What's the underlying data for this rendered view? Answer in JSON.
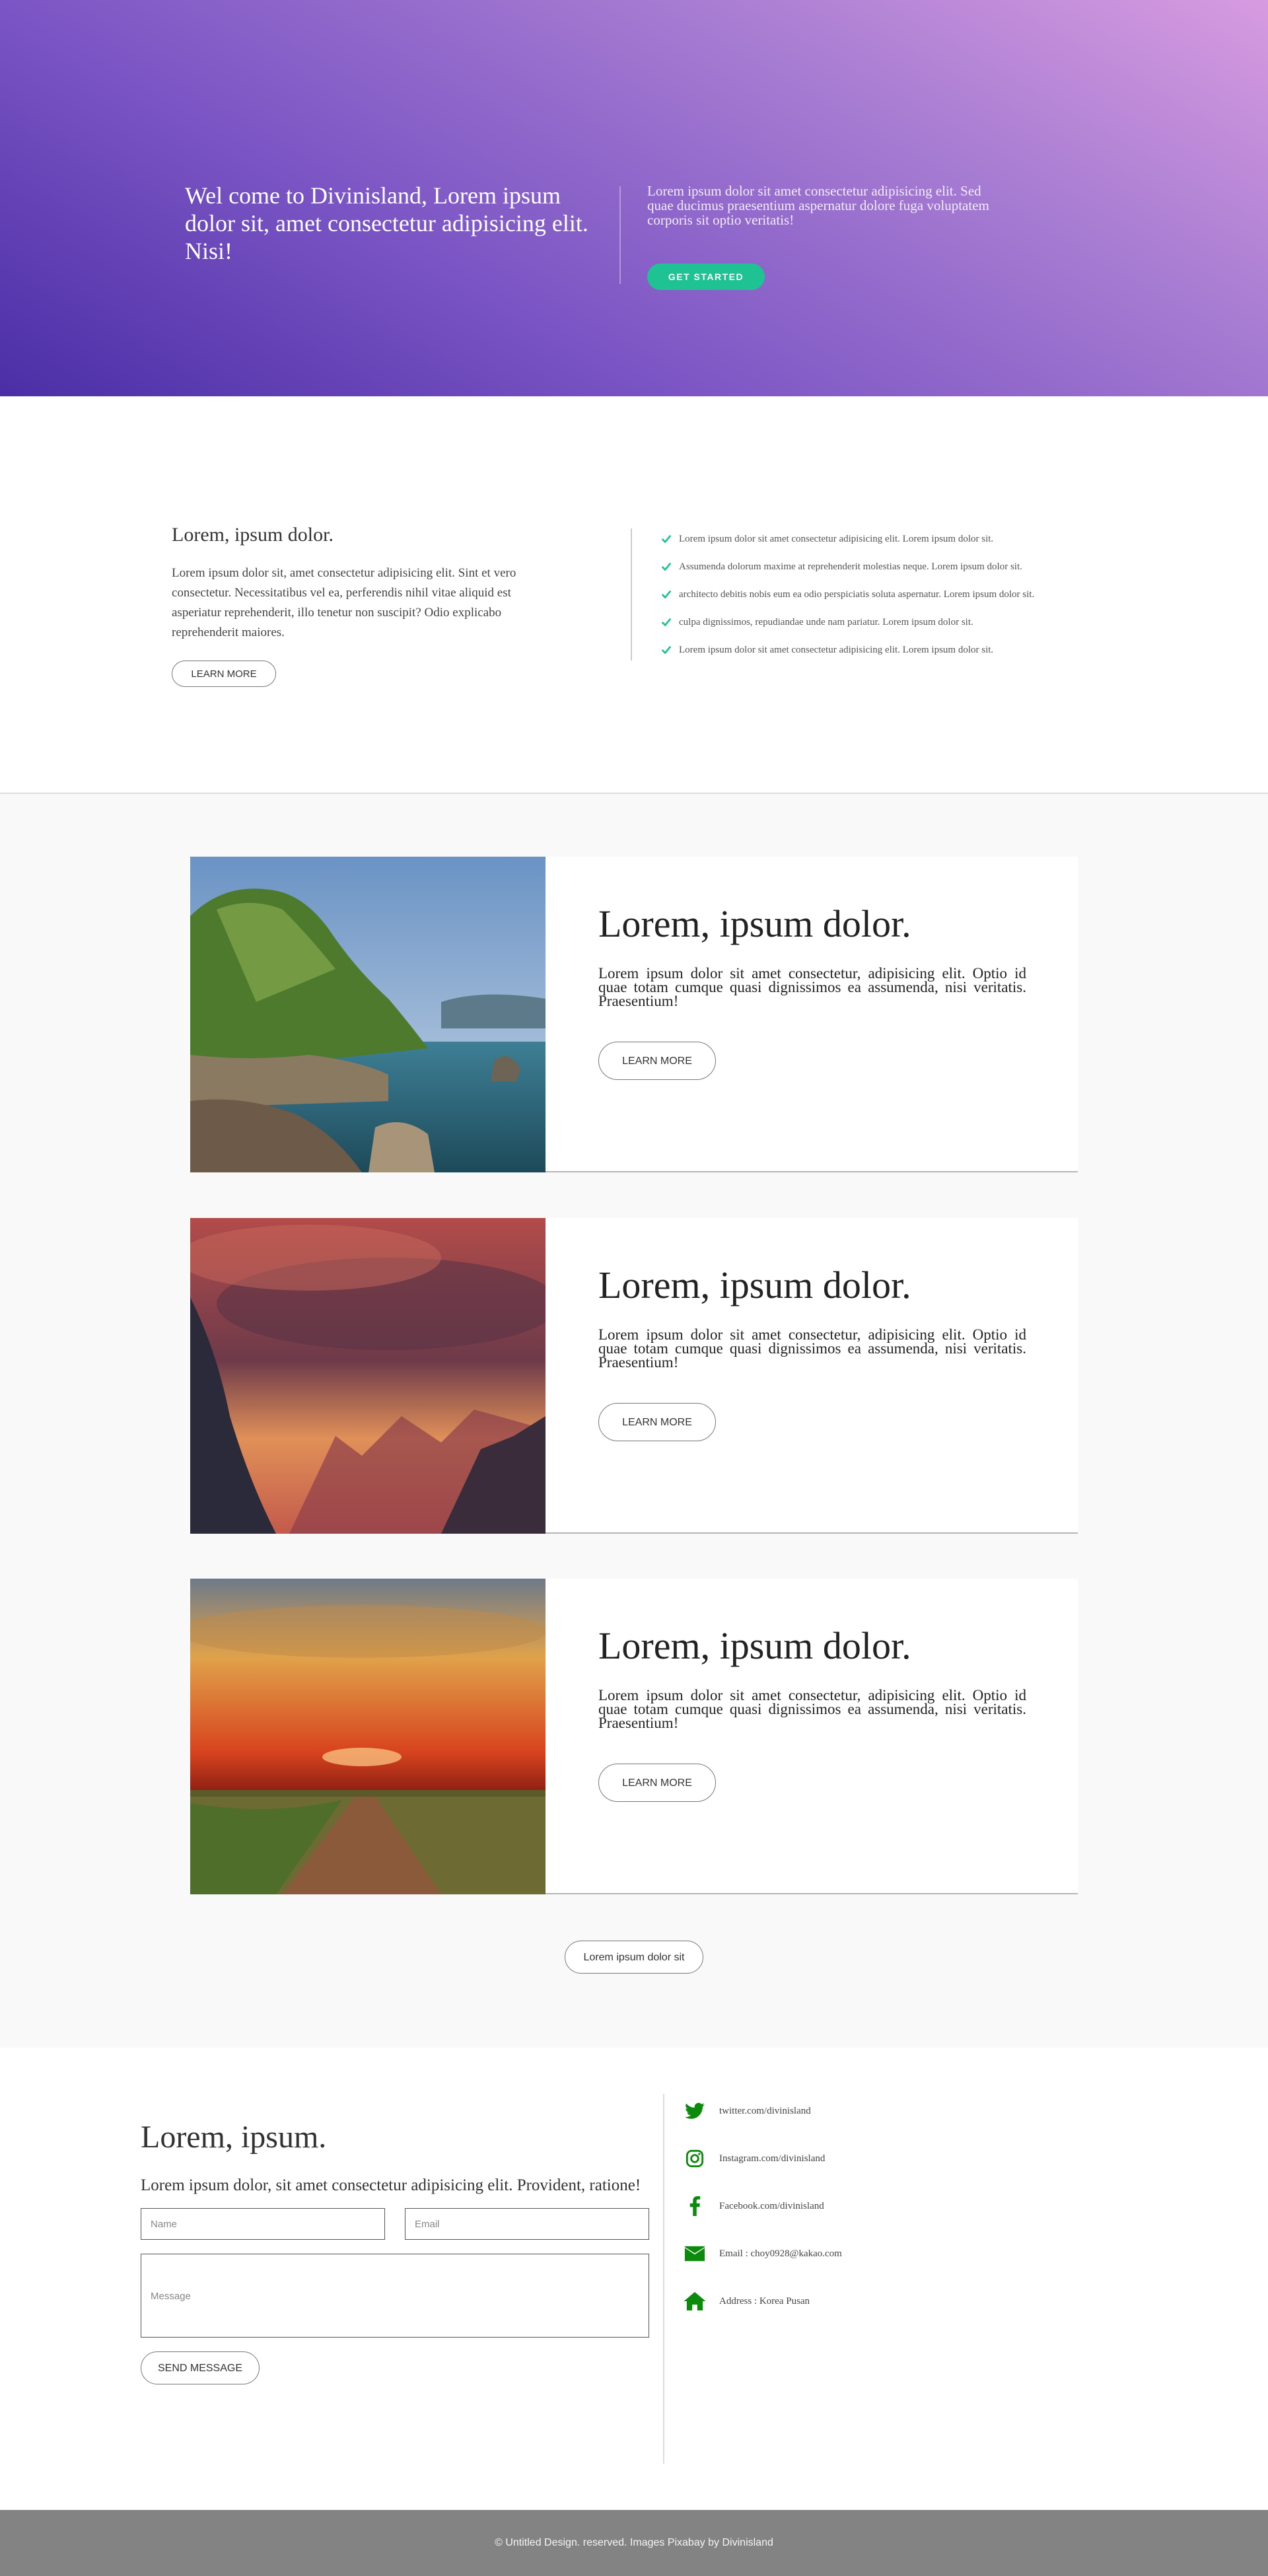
{
  "hero": {
    "title": "Wel come to Divinisland, Lorem ipsum dolor sit, amet consectetur adipisicing elit. Nisi!",
    "text": "Lorem ipsum dolor sit amet consectetur adipisicing elit. Sed quae ducimus praesentium aspernatur dolore fuga voluptatem corporis sit optio veritatis!",
    "button_label": "GET STARTED",
    "accent_color": "#1fc393"
  },
  "intro": {
    "title": "Lorem, ipsum dolor.",
    "text": "Lorem ipsum dolor sit, amet consectetur adipisicing elit. Sint et vero consectetur. Necessitatibus vel ea, perferendis nihil vitae aliquid est asperiatur reprehenderit, illo tenetur non suscipit? Odio explicabo reprehenderit maiores.",
    "button_label": "LEARN MORE",
    "checklist": [
      "Lorem ipsum dolor sit amet consectetur adipisicing elit. Lorem ipsum dolor sit.",
      "Assumenda dolorum maxime at reprehenderit molestias neque. Lorem ipsum dolor sit.",
      "architecto debitis nobis eum ea odio perspiciatis soluta aspernatur. Lorem ipsum dolor sit.",
      "culpa dignissimos, repudiandae unde nam pariatur. Lorem ipsum dolor sit.",
      "Lorem ipsum dolor sit amet consectetur adipisicing elit. Lorem ipsum dolor sit."
    ],
    "check_icon": "check-icon",
    "check_color": "#1fc393"
  },
  "cards": [
    {
      "image": "coastal-cliff-landscape",
      "title": "Lorem, ipsum dolor.",
      "text": "Lorem ipsum dolor sit amet consectetur, adipisicing elit. Optio id quae totam cumque quasi dignissimos ea assumenda, nisi veritatis. Praesentium!",
      "button_label": "LEARN MORE"
    },
    {
      "image": "misty-mountain-sunset",
      "title": "Lorem, ipsum dolor.",
      "text": "Lorem ipsum dolor sit amet consectetur, adipisicing elit. Optio id quae totam cumque quasi dignissimos ea assumenda, nisi veritatis. Praesentium!",
      "button_label": "LEARN MORE"
    },
    {
      "image": "field-road-sunset",
      "title": "Lorem, ipsum dolor.",
      "text": "Lorem ipsum dolor sit amet consectetur, adipisicing elit. Optio id quae totam cumque quasi dignissimos ea assumenda, nisi veritatis. Praesentium!",
      "button_label": "LEARN MORE"
    }
  ],
  "more_button_label": "Lorem ipsum dolor sit",
  "contact": {
    "title": "Lorem, ipsum.",
    "text": "Lorem ipsum dolor, sit amet consectetur adipisicing elit. Provident, ratione!",
    "name_placeholder": "Name",
    "email_placeholder": "Email",
    "message_placeholder": "Message",
    "send_label": "SEND MESSAGE",
    "social": [
      {
        "icon": "twitter-icon",
        "label": "twitter.com/divinisland"
      },
      {
        "icon": "instagram-icon",
        "label": "Instagram.com/divinisland"
      },
      {
        "icon": "facebook-icon",
        "label": "Facebook.com/divinisland"
      },
      {
        "icon": "email-icon",
        "label": "Email : choy0928@kakao.com"
      },
      {
        "icon": "home-icon",
        "label": "Address : Korea Pusan"
      }
    ],
    "social_color": "#0b8a0b"
  },
  "footer": {
    "text": "© Untitled Design. reserved. Images Pixabay by Divinisland"
  }
}
